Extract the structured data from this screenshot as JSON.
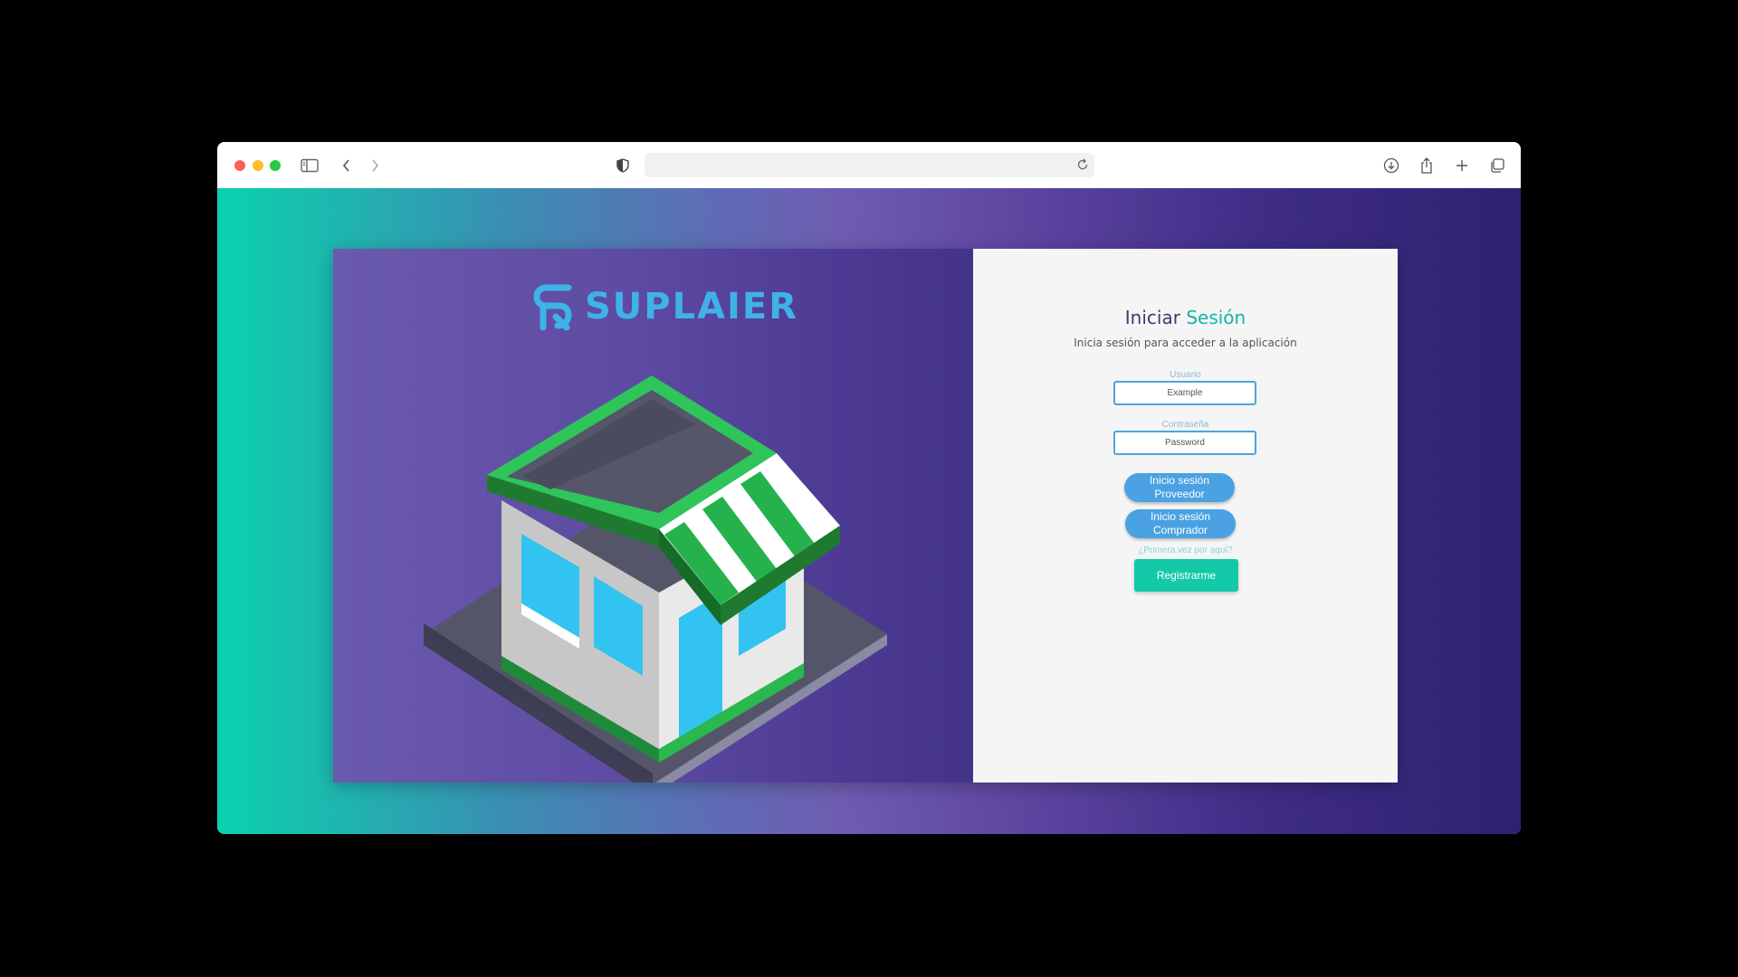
{
  "browser": {
    "address": "",
    "colors": {
      "close": "#ff5f57",
      "minimize": "#febc2e",
      "zoom": "#28c840"
    }
  },
  "brand": {
    "name": "SUPLAIER",
    "color": "#3fb2e8"
  },
  "login": {
    "title_main": "Iniciar",
    "title_accent": "Sesión",
    "subtitle": "Inicia sesión para acceder a la aplicación",
    "username_label": "Usuario",
    "username_placeholder": "Example",
    "password_label": "Contraseña",
    "password_placeholder": "Password",
    "provider_button_line1": "Inicio sesión",
    "provider_button_line2": "Proveedor",
    "buyer_button_line1": "Inicio sesión",
    "buyer_button_line2": "Comprador",
    "first_time_link": "¿Primera vez por aquí?",
    "register_button": "Registrarme"
  },
  "colors": {
    "accent": "#13c9a8",
    "primary_button": "#4aa2e3",
    "title": "#3d3a6e"
  }
}
